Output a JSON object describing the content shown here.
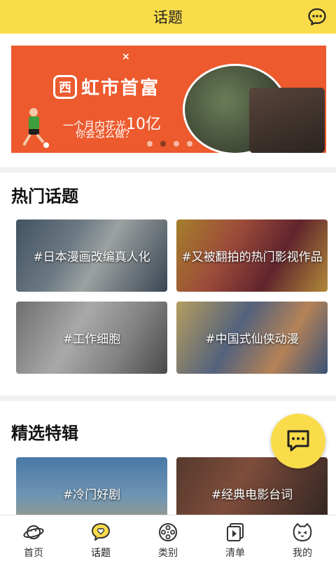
{
  "header": {
    "title": "话题",
    "message_icon": "chat-bubble-icon"
  },
  "banner": {
    "logo_char": "西",
    "brand": "虹市首富",
    "line1_prefix": "一个月内花光",
    "line1_amount": "10亿",
    "line2": "你会怎么做？",
    "close_mark": "×",
    "accent": "#ec5a2e",
    "active_dot": 1
  },
  "hot_topics": {
    "title": "热门话题",
    "items": [
      {
        "label": "#日本漫画改编真人化"
      },
      {
        "label": "#又被翻拍的热门影视作品"
      },
      {
        "label": "#工作细胞"
      },
      {
        "label": "#中国式仙侠动漫"
      }
    ]
  },
  "featured": {
    "title": "精选特辑",
    "items": [
      {
        "label": "#冷门好剧"
      },
      {
        "label": "#经典电影台词"
      }
    ]
  },
  "fab": {
    "icon": "comment-icon"
  },
  "tabbar": {
    "active": "话题",
    "items": [
      {
        "label": "首页",
        "icon": "planet-icon"
      },
      {
        "label": "话题",
        "icon": "heart-bubble-icon"
      },
      {
        "label": "类别",
        "icon": "film-reel-icon"
      },
      {
        "label": "清单",
        "icon": "playlist-icon"
      },
      {
        "label": "我的",
        "icon": "cat-face-icon"
      }
    ]
  },
  "colors": {
    "brand_yellow": "#fadc4a",
    "background": "#f2f2f2"
  }
}
